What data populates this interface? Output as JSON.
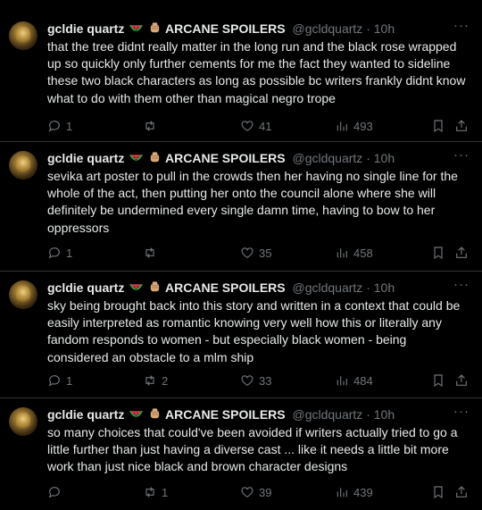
{
  "colors": {
    "background": "#000000",
    "text": "#e7e9ea",
    "muted": "#71767b",
    "divider": "#2f3336"
  },
  "top_strip": {
    "reply": "",
    "retweet": "",
    "like": "",
    "views": ""
  },
  "tweets": [
    {
      "name": "gcldie quartz",
      "emojis": [
        "watermelon-emoji",
        "raised-fist-emoji"
      ],
      "display_suffix": "ARCANE SPOILERS",
      "handle_time": "@gcldquartz · 10h",
      "more": "···",
      "text": "that the tree didnt really matter in the long run and the black rose wrapped up so quickly only further cements for me the fact they wanted to sideline these two black characters as long as possible bc writers frankly didnt know what to do with them other than magical negro trope",
      "replies": "1",
      "retweets": "",
      "likes": "41",
      "views": "493"
    },
    {
      "name": "gcldie quartz",
      "emojis": [
        "watermelon-emoji",
        "raised-fist-emoji"
      ],
      "display_suffix": "ARCANE SPOILERS",
      "handle_time": "@gcldquartz · 10h",
      "more": "···",
      "text": "sevika art poster to pull in the crowds then her having no single line for the whole of the act, then putting her onto the council alone where she will definitely be undermined every single damn time, having to bow to her oppressors",
      "replies": "1",
      "retweets": "",
      "likes": "35",
      "views": "458"
    },
    {
      "name": "gcldie quartz",
      "emojis": [
        "watermelon-emoji",
        "raised-fist-emoji"
      ],
      "display_suffix": "ARCANE SPOILERS",
      "handle_time": "@gcldquartz · 10h",
      "more": "···",
      "text": "sky being brought back into this story and written in a context that could be easily interpreted as romantic knowing very well how this or literally any fandom responds to women - but especially black women - being considered an obstacle to a mlm ship",
      "replies": "1",
      "retweets": "2",
      "likes": "33",
      "views": "484"
    },
    {
      "name": "gcldie quartz",
      "emojis": [
        "watermelon-emoji",
        "raised-fist-emoji"
      ],
      "display_suffix": "ARCANE SPOILERS",
      "handle_time": "@gcldquartz · 10h",
      "more": "···",
      "text": "so many choices that could've been avoided if writers actually tried to go a little further than just having a diverse cast ... like it needs a little bit more work than just nice black and brown character designs",
      "replies": "",
      "retweets": "1",
      "likes": "39",
      "views": "439"
    }
  ]
}
